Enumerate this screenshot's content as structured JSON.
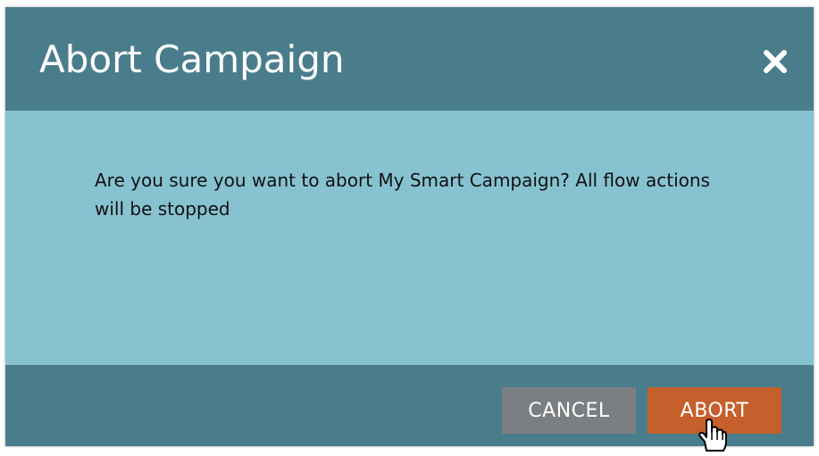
{
  "dialog": {
    "title": "Abort Campaign",
    "close_icon": "close-icon",
    "message": "Are you sure you want to abort My Smart Campaign? All flow actions will be stopped",
    "buttons": {
      "cancel_label": "CANCEL",
      "abort_label": "ABORT"
    }
  },
  "colors": {
    "header": "#4a7d8c",
    "body": "#87c2d1",
    "cancel_button": "#7b7f81",
    "abort_button": "#c55f2b"
  },
  "cursor_icon": "hand-pointer-icon"
}
